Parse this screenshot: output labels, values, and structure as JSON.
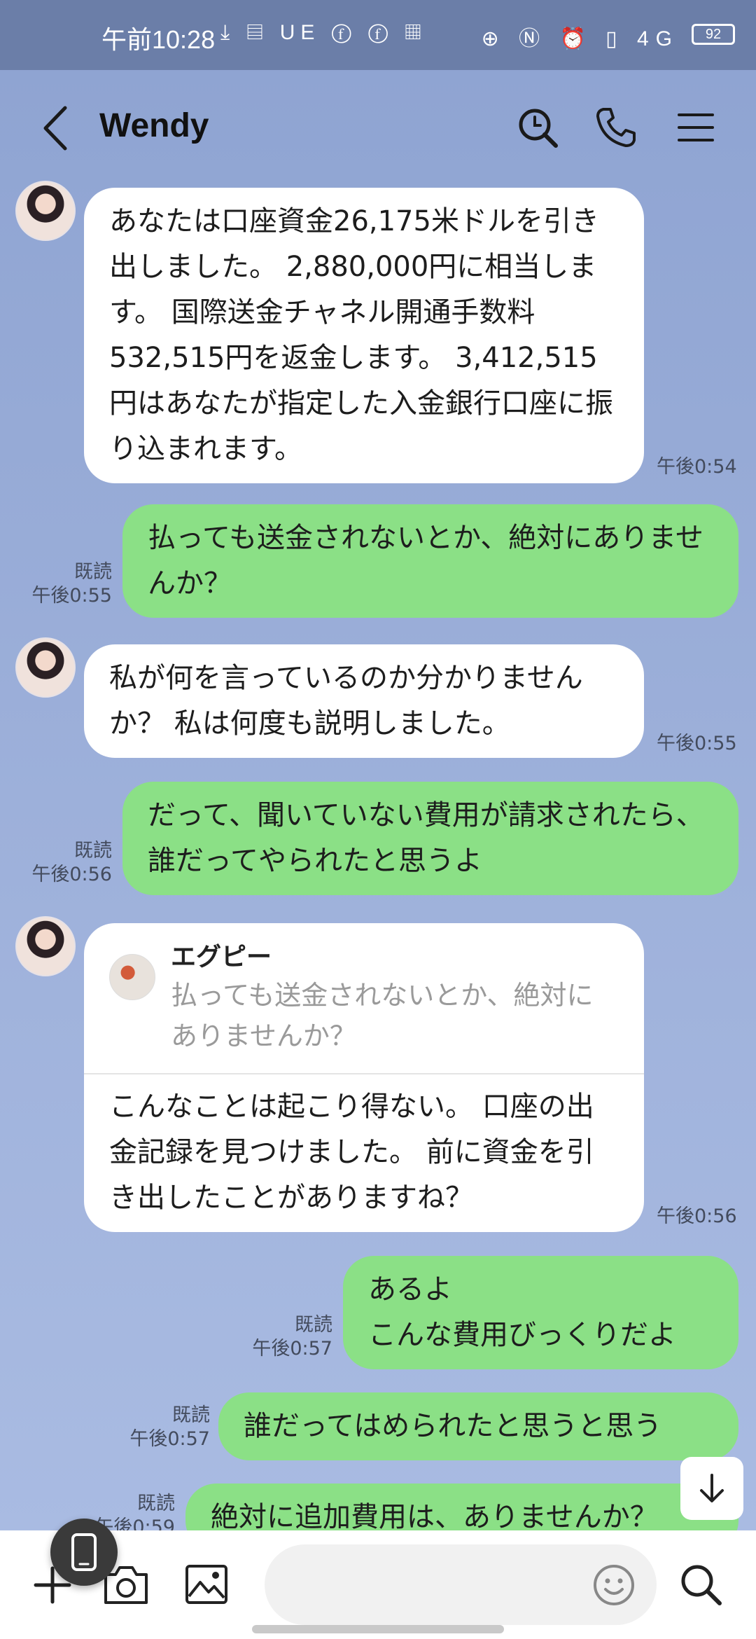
{
  "status_bar": {
    "time": "午前10:28",
    "left_icons": "⤓ ▤ UE ⓕ ⓕ ▦",
    "right_icons": "⊕ Ⓝ ⏰ ▯ 4G",
    "battery": "92"
  },
  "header": {
    "title": "Wendy"
  },
  "messages": [
    {
      "kind": "in",
      "text": "あなたは口座資金26,175米ドルを引き出しました。 2,880,000円に相当します。 国際送金チャネル開通手数料532,515円を返金します。 3,412,515円はあなたが指定した入金銀行口座に振り込まれます。",
      "time": "午後0:54"
    },
    {
      "kind": "out",
      "text": "払っても送金されないとか、絶対にありませんか？",
      "read": "既読",
      "time": "午後0:55"
    },
    {
      "kind": "in",
      "text": "私が何を言っているのか分かりませんか？ 私は何度も説明しました。",
      "time": "午後0:55"
    },
    {
      "kind": "out",
      "text": "だって、聞いていない費用が請求されたら、誰だってやられたと思うよ",
      "read": "既読",
      "time": "午後0:56"
    },
    {
      "kind": "in",
      "reply_name": "エグピー",
      "reply_text": "払っても送金されないとか、絶対にありませんか？",
      "text": "こんなことは起こり得ない。 口座の出金記録を見つけました。 前に資金を引き出したことがありますね？",
      "time": "午後0:56"
    },
    {
      "kind": "out",
      "text": "あるよ\nこんな費用びっくりだよ",
      "read": "既読",
      "time": "午後0:57"
    },
    {
      "kind": "out",
      "text": "誰だってはめられたと思うと思う",
      "read": "既読",
      "time": "午後0:57"
    },
    {
      "kind": "out",
      "text": "絶対に追加費用は、ありませんか？",
      "read": "既読",
      "time": "午後0:59"
    }
  ],
  "colors": {
    "chat_bg": "#8fa3cf",
    "incoming": "#ffffff",
    "outgoing": "#8be086"
  },
  "icons": [
    "back-arrow",
    "search",
    "phone",
    "menu",
    "plus",
    "camera",
    "image",
    "emoji",
    "search",
    "arrow-down",
    "phone-device"
  ]
}
